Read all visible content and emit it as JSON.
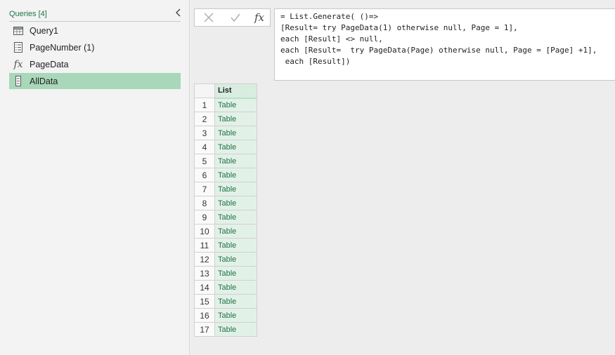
{
  "queries": {
    "title": "Queries [4]",
    "items": [
      {
        "label": "Query1",
        "icon": "table-icon"
      },
      {
        "label": "PageNumber (1)",
        "icon": "list-icon"
      },
      {
        "label": "PageData",
        "icon": "function-icon"
      },
      {
        "label": "AllData",
        "icon": "list-column-icon",
        "selected": true
      }
    ]
  },
  "toolbar": {
    "cancel_icon": "close-icon",
    "commit_icon": "check-icon",
    "fx_label": "fx"
  },
  "formula": {
    "lines": [
      "= List.Generate( ()=>",
      "[Result= try PageData(1) otherwise null, Page = 1],",
      "each [Result] <> null,",
      "each [Result=  try PageData(Page) otherwise null, Page = [Page] +1],",
      " each [Result])"
    ]
  },
  "grid": {
    "column_header": "List",
    "rows": [
      {
        "n": "1",
        "v": "Table"
      },
      {
        "n": "2",
        "v": "Table"
      },
      {
        "n": "3",
        "v": "Table"
      },
      {
        "n": "4",
        "v": "Table"
      },
      {
        "n": "5",
        "v": "Table"
      },
      {
        "n": "6",
        "v": "Table"
      },
      {
        "n": "7",
        "v": "Table"
      },
      {
        "n": "8",
        "v": "Table"
      },
      {
        "n": "9",
        "v": "Table"
      },
      {
        "n": "10",
        "v": "Table"
      },
      {
        "n": "11",
        "v": "Table"
      },
      {
        "n": "12",
        "v": "Table"
      },
      {
        "n": "13",
        "v": "Table"
      },
      {
        "n": "14",
        "v": "Table"
      },
      {
        "n": "15",
        "v": "Table"
      },
      {
        "n": "16",
        "v": "Table"
      },
      {
        "n": "17",
        "v": "Table"
      }
    ]
  },
  "colors": {
    "accent": "#217346",
    "selected": "#a8d8b9",
    "cell": "#e2f1e7"
  }
}
